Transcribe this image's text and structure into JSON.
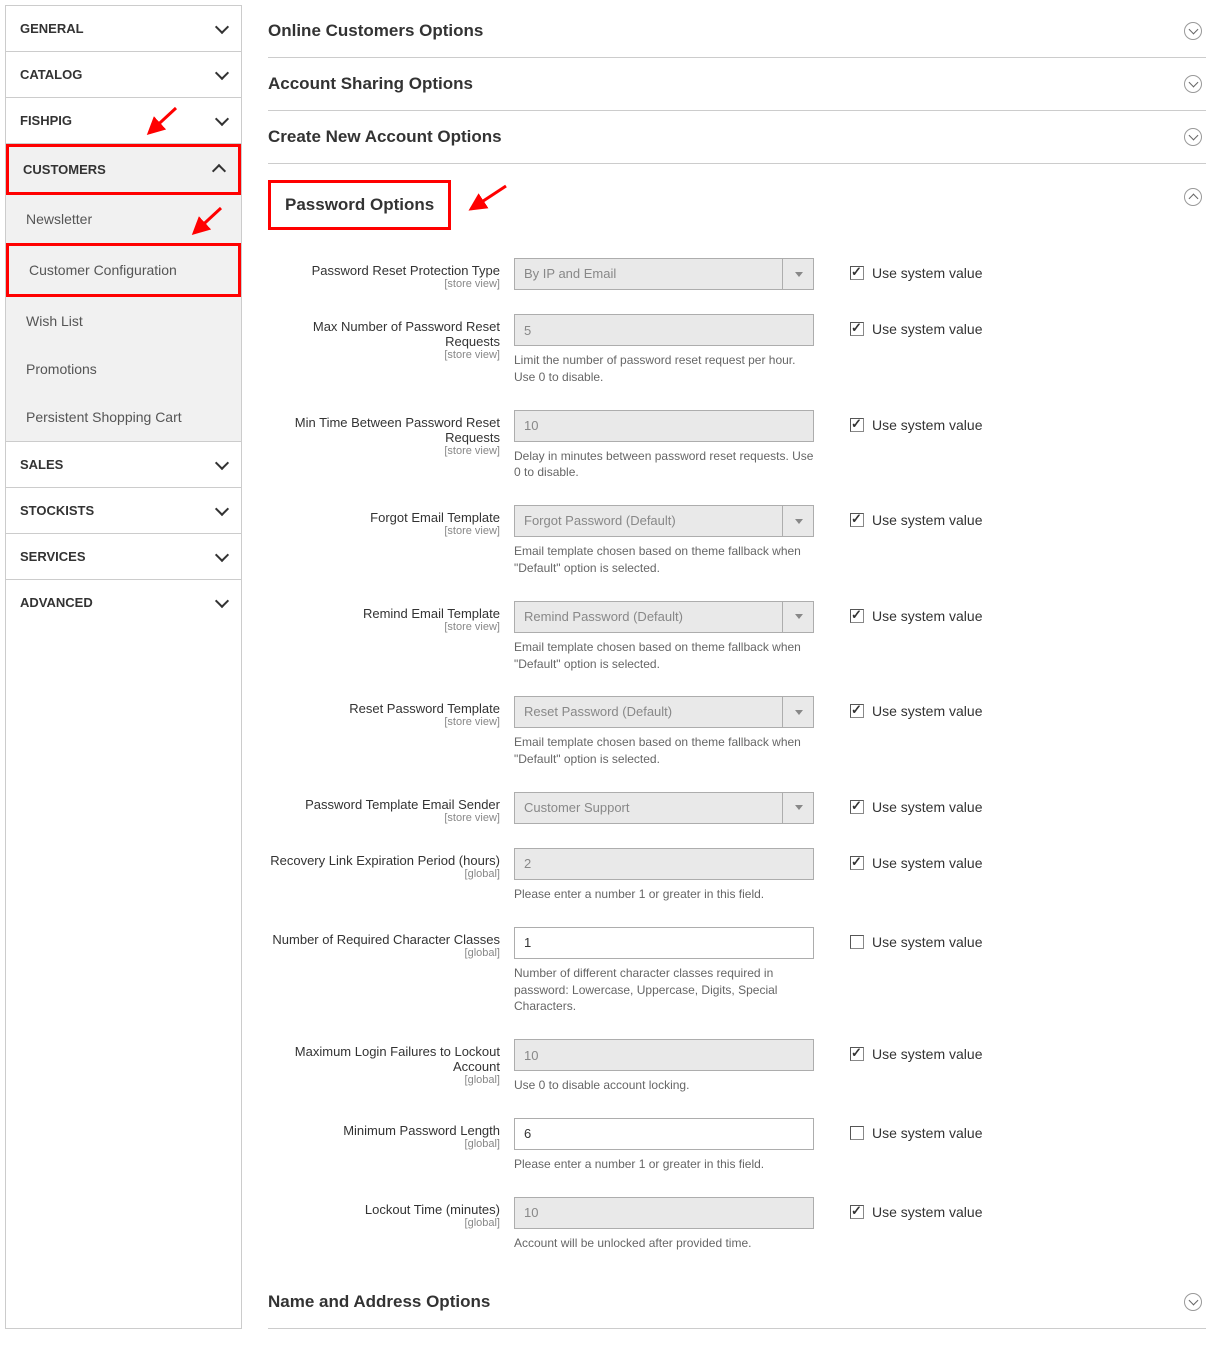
{
  "sidebar": {
    "sections": [
      {
        "label": "GENERAL",
        "expanded": false
      },
      {
        "label": "CATALOG",
        "expanded": false
      },
      {
        "label": "FISHPIG",
        "expanded": false
      },
      {
        "label": "CUSTOMERS",
        "expanded": true,
        "highlighted": true
      },
      {
        "label": "SALES",
        "expanded": false
      },
      {
        "label": "STOCKISTS",
        "expanded": false
      },
      {
        "label": "SERVICES",
        "expanded": false
      },
      {
        "label": "ADVANCED",
        "expanded": false
      }
    ],
    "customerSub": [
      {
        "label": "Newsletter"
      },
      {
        "label": "Customer Configuration",
        "highlighted": true
      },
      {
        "label": "Wish List"
      },
      {
        "label": "Promotions"
      },
      {
        "label": "Persistent Shopping Cart"
      }
    ]
  },
  "sections": {
    "onlineCustomers": "Online Customers Options",
    "accountSharing": "Account Sharing Options",
    "createNew": "Create New Account Options",
    "password": "Password Options",
    "nameAddress": "Name and Address Options"
  },
  "form": {
    "useSystemLabel": "Use system value",
    "scopeStore": "[store view]",
    "scopeGlobal": "[global]",
    "rows": {
      "resetProtection": {
        "label": "Password Reset Protection Type",
        "value": "By IP and Email",
        "checked": true,
        "disabled": true,
        "type": "select"
      },
      "maxRequests": {
        "label": "Max Number of Password Reset Requests",
        "value": "5",
        "note": "Limit the number of password reset request per hour. Use 0 to disable.",
        "checked": true,
        "disabled": true,
        "type": "text"
      },
      "minTime": {
        "label": "Min Time Between Password Reset Requests",
        "value": "10",
        "note": "Delay in minutes between password reset requests. Use 0 to disable.",
        "checked": true,
        "disabled": true,
        "type": "text"
      },
      "forgotTemplate": {
        "label": "Forgot Email Template",
        "value": "Forgot Password (Default)",
        "note": "Email template chosen based on theme fallback when \"Default\" option is selected.",
        "checked": true,
        "disabled": true,
        "type": "select"
      },
      "remindTemplate": {
        "label": "Remind Email Template",
        "value": "Remind Password (Default)",
        "note": "Email template chosen based on theme fallback when \"Default\" option is selected.",
        "checked": true,
        "disabled": true,
        "type": "select"
      },
      "resetTemplate": {
        "label": "Reset Password Template",
        "value": "Reset Password (Default)",
        "note": "Email template chosen based on theme fallback when \"Default\" option is selected.",
        "checked": true,
        "disabled": true,
        "type": "select"
      },
      "emailSender": {
        "label": "Password Template Email Sender",
        "value": "Customer Support",
        "checked": true,
        "disabled": true,
        "type": "select"
      },
      "recoveryExpiration": {
        "label": "Recovery Link Expiration Period (hours)",
        "value": "2",
        "note": "Please enter a number 1 or greater in this field.",
        "checked": true,
        "disabled": true,
        "type": "text",
        "scope": "global"
      },
      "charClasses": {
        "label": "Number of Required Character Classes",
        "value": "1",
        "note": "Number of different character classes required in password: Lowercase, Uppercase, Digits, Special Characters.",
        "checked": false,
        "disabled": false,
        "type": "text",
        "scope": "global"
      },
      "lockoutFailures": {
        "label": "Maximum Login Failures to Lockout Account",
        "value": "10",
        "note": "Use 0 to disable account locking.",
        "checked": true,
        "disabled": true,
        "type": "text",
        "scope": "global"
      },
      "minLength": {
        "label": "Minimum Password Length",
        "value": "6",
        "note": "Please enter a number 1 or greater in this field.",
        "checked": false,
        "disabled": false,
        "type": "text",
        "scope": "global"
      },
      "lockoutTime": {
        "label": "Lockout Time (minutes)",
        "value": "10",
        "note": "Account will be unlocked after provided time.",
        "checked": true,
        "disabled": true,
        "type": "text",
        "scope": "global"
      }
    }
  }
}
